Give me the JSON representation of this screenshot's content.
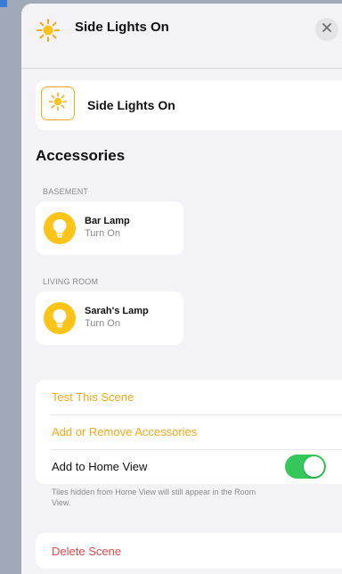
{
  "header": {
    "title": "Side Lights On",
    "icon": "sun-icon",
    "close_icon": "close-icon"
  },
  "scene_name": {
    "value": "Side Lights On",
    "icon": "sun-icon"
  },
  "accessories": {
    "title": "Accessories",
    "rooms": [
      {
        "label": "BASEMENT",
        "items": [
          {
            "name": "Bar Lamp",
            "state": "Turn On",
            "icon": "lightbulb-icon"
          }
        ]
      },
      {
        "label": "LIVING ROOM",
        "items": [
          {
            "name": "Sarah's Lamp",
            "state": "Turn On",
            "icon": "lightbulb-icon"
          }
        ]
      }
    ]
  },
  "actions": {
    "test_scene": "Test This Scene",
    "add_remove": "Add or Remove Accessories",
    "add_home_view": "Add to Home View",
    "add_home_view_on": true,
    "footnote": "Tiles hidden from Home View will still appear in the Room View."
  },
  "delete": {
    "label": "Delete Scene"
  },
  "colors": {
    "accent": "#f7a81b",
    "toggle_on": "#34c759",
    "destructive": "#e5484d",
    "bulb": "#fcc419"
  }
}
